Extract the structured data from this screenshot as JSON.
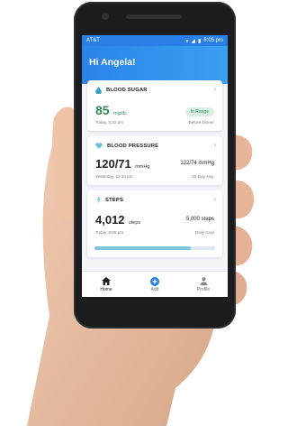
{
  "status": {
    "carrier": "AT&T",
    "time": "8:05 pm"
  },
  "header": {
    "greeting": "Hi Angela!"
  },
  "cards": {
    "blood_sugar": {
      "title": "BLOOD SUGAR",
      "value": "85",
      "unit": "mg/dL",
      "timestamp": "Today, 5:32 pm",
      "badge": "In Range",
      "context": "Before Dinner"
    },
    "blood_pressure": {
      "title": "BLOOD PRESSURE",
      "value": "120/71",
      "unit": "mmHg",
      "timestamp": "Yesterday, 12:14 pm",
      "avg_value": "122/74 mmHg",
      "avg_label": "30-Day Avg."
    },
    "steps": {
      "title": "STEPS",
      "value": "4,012",
      "unit": "steps",
      "timestamp": "Today, 8:05 pm",
      "goal_value": "5,000 steps",
      "goal_label": "Daily Goal",
      "progress": 0.8
    }
  },
  "nav": {
    "home": "Home",
    "add": "Add",
    "profile": "Profile"
  },
  "colors": {
    "accent": "#2a7fe6",
    "in_range": "#2f8a57",
    "progress": "#7cc6dd"
  }
}
